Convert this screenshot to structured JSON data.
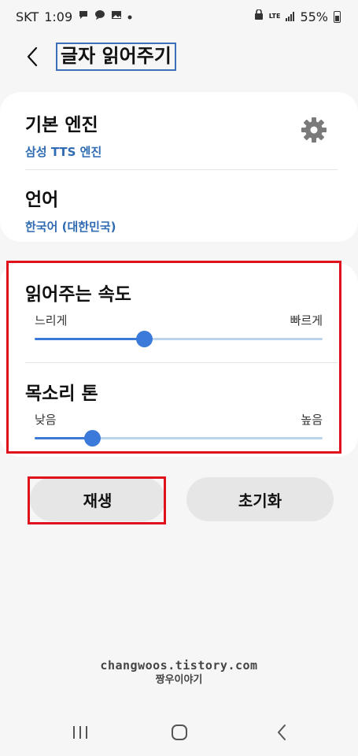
{
  "status_bar": {
    "carrier": "SKT",
    "time": "1:09",
    "battery": "55%",
    "network": "LTE"
  },
  "header": {
    "title": "글자 읽어주기"
  },
  "engine_section": {
    "engine_label": "기본 엔진",
    "engine_value": "삼성 TTS 엔진",
    "language_label": "언어",
    "language_value": "한국어 (대한민국)"
  },
  "speed": {
    "label": "읽어주는 속도",
    "min_label": "느리게",
    "max_label": "빠르게",
    "value": 0.38
  },
  "pitch": {
    "label": "목소리 톤",
    "min_label": "낮음",
    "max_label": "높음",
    "value": 0.2
  },
  "buttons": {
    "play": "재생",
    "reset": "초기화"
  },
  "watermark": {
    "line1": "changwoos.tistory.com",
    "line2": "짱우이야기"
  },
  "colors": {
    "accent": "#3b7ad9",
    "link": "#2f6bb2",
    "highlight": "#e0111c"
  }
}
